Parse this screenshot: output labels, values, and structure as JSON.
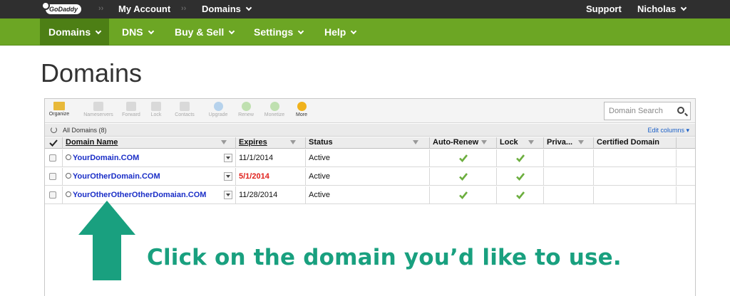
{
  "topbar": {
    "logo": "GoDaddy",
    "my_account": "My Account",
    "domains": "Domains",
    "support": "Support",
    "user": "Nicholas"
  },
  "nav": {
    "items": [
      "Domains",
      "DNS",
      "Buy & Sell",
      "Settings",
      "Help"
    ]
  },
  "page": {
    "title": "Domains"
  },
  "toolbar": {
    "organize": "Organize",
    "nameservers": "Nameservers",
    "forward": "Forward",
    "lock": "Lock",
    "contacts": "Contacts",
    "upgrade": "Upgrade",
    "renew": "Renew",
    "monetize": "Monetize",
    "more": "More",
    "search_placeholder": "Domain Search"
  },
  "subbar": {
    "all_domains": "All Domains (8)",
    "edit_columns": "Edit columns ▾"
  },
  "table": {
    "headers": {
      "domain": "Domain Name",
      "expires": "Expires",
      "status": "Status",
      "autorenew": "Auto-Renew",
      "lock": "Lock",
      "privacy": "Priva...",
      "certified": "Certified Domain"
    },
    "rows": [
      {
        "domain": "YourDomain.COM",
        "expires": "11/1/2014",
        "status": "Active",
        "expired_highlight": false
      },
      {
        "domain": "YourOtherDomain.COM",
        "expires": "5/1/2014",
        "status": "Active",
        "expired_highlight": true
      },
      {
        "domain": "YourOtherOtherOtherDomaian.COM",
        "expires": "11/28/2014",
        "status": "Active",
        "expired_highlight": false
      }
    ]
  },
  "annotation": {
    "text": "Click on the domain you’d like to use."
  },
  "colors": {
    "nav_green": "#6ca624",
    "nav_active": "#4d7f15",
    "annotation_teal": "#19a07f",
    "link_blue": "#1a2ec7",
    "expiry_red": "#e0201b"
  }
}
